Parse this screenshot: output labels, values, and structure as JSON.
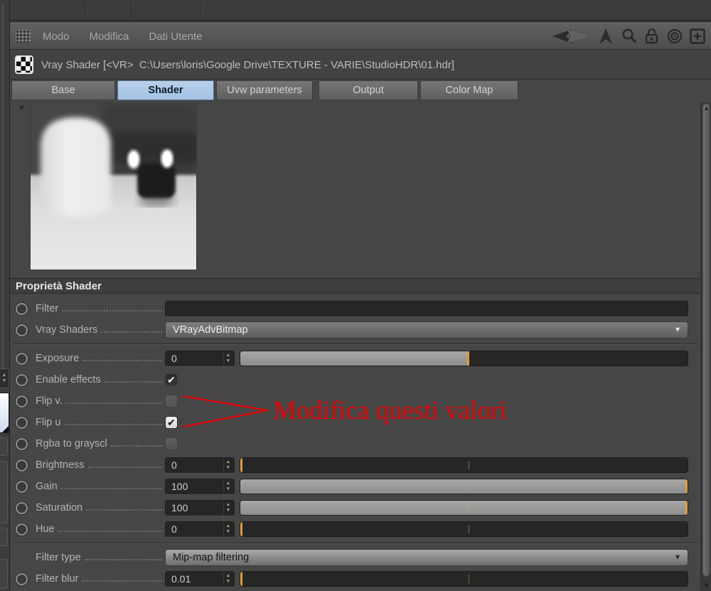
{
  "colors": {
    "accent_orange": "#e59d35",
    "selected_tab_blue": "#a9c7e7",
    "annotation_red": "#e60000",
    "slider_fill_gray": "#9b9b9b",
    "panel_background": "#464646"
  },
  "glyphs": {
    "check": "✔",
    "spinner_up": "▲",
    "spinner_down": "▼",
    "dropdown_arrow": "▼",
    "collapse": "▼",
    "scroll_up": "▲",
    "scroll_down": "▼"
  },
  "menu": {
    "items": [
      "Modo",
      "Modifica",
      "Dati Utente"
    ]
  },
  "titlebar": {
    "title": "Vray Shader [<VR>  C:\\Users\\loris\\Google Drive\\TEXTURE - VARIE\\StudioHDR\\01.hdr]"
  },
  "tabs": [
    {
      "label": "Base",
      "active": false
    },
    {
      "label": "Shader",
      "active": true
    },
    {
      "label": "Uvw parameters",
      "active": false
    },
    {
      "label": "Output",
      "active": false
    },
    {
      "label": "Color Map",
      "active": false
    }
  ],
  "section": {
    "title": "Proprietà Shader"
  },
  "params": {
    "filter": {
      "label": "Filter",
      "value": "",
      "type": "text"
    },
    "vray_shaders": {
      "label": "Vray Shaders",
      "value": "VRayAdvBitmap",
      "type": "dropdown"
    },
    "exposure": {
      "label": "Exposure",
      "value": "0",
      "slider": {
        "fill_pct": 51,
        "marker_pct": 51
      }
    },
    "enable_effects": {
      "label": "Enable effects",
      "checked": true,
      "variant": "dark"
    },
    "flip_v": {
      "label": "Flip v.",
      "checked": false
    },
    "flip_u": {
      "label": "Flip u",
      "checked": true,
      "variant": "light"
    },
    "rgba_to_grayscl": {
      "label": "Rgba to grayscl",
      "checked": false
    },
    "brightness": {
      "label": "Brightness",
      "value": "0",
      "slider": {
        "fill_pct": 0,
        "marker_pct": 0
      }
    },
    "gain": {
      "label": "Gain",
      "value": "100",
      "slider": {
        "fill_pct": 100,
        "marker_pct": 100
      }
    },
    "saturation": {
      "label": "Saturation",
      "value": "100",
      "slider": {
        "fill_pct": 100,
        "marker_pct": 100
      }
    },
    "hue": {
      "label": "Hue",
      "value": "0",
      "slider": {
        "fill_pct": 0,
        "marker_pct": 0
      }
    },
    "filter_type": {
      "label": "Filter type",
      "value": "Mip-map filtering",
      "type": "dropdown"
    },
    "filter_blur": {
      "label": "Filter blur",
      "value": "0.01",
      "slider": {
        "fill_pct": 0,
        "marker_pct": 0
      }
    }
  },
  "annotation": {
    "text": "Modifica questi valori",
    "color": "#e60000"
  }
}
